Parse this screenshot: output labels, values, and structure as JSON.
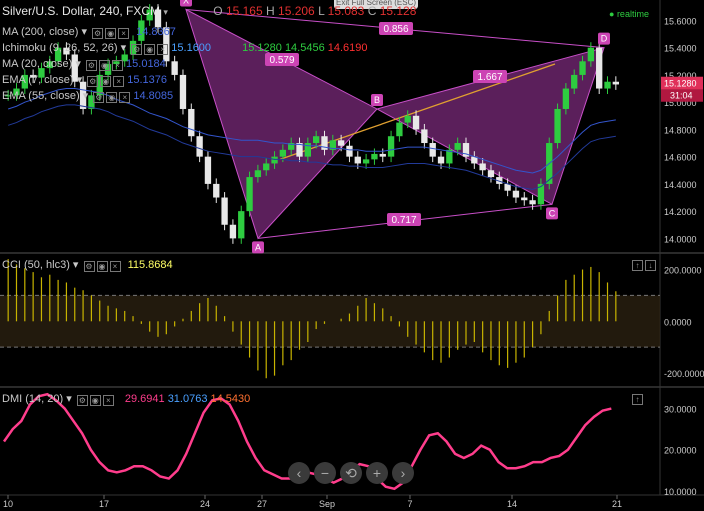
{
  "header": {
    "symbol": "Silver/U.S. Dollar, 240, FXCM",
    "ohlc": {
      "o_label": "O",
      "o": "15.165",
      "h_label": "H",
      "h": "15.206",
      "l_label": "L",
      "l": "15.083",
      "c_label": "C",
      "c": "15.128"
    },
    "realtime_label": "realtime",
    "exit_full_screen": "Exit Full Screen (ESC)"
  },
  "indicators": {
    "ma200": {
      "label": "MA (200, close)",
      "value": "14.8367"
    },
    "ichimoku": {
      "label": "Ichimoku (9, 26, 52, 26)",
      "values": [
        "15.1600",
        "15.1280",
        "14.5456",
        "14.6190"
      ]
    },
    "ma20": {
      "label": "MA (20, close)",
      "value": "15.0184"
    },
    "ema7": {
      "label": "EMA (7, close)",
      "value": "15.1376"
    },
    "ema55": {
      "label": "EMA (55, close)",
      "value": "14.8085"
    }
  },
  "cci_panel": {
    "label": "CCI (50, hlc3)",
    "value": "115.8684"
  },
  "dmi_panel": {
    "label": "DMI (14, 20)",
    "values": [
      "29.6941",
      "31.0763",
      "14.5430"
    ]
  },
  "price_tag": {
    "value": "15.1280",
    "countdown": "31:04"
  },
  "harmonic": {
    "points": [
      {
        "label": "X",
        "x": 21.0,
        "y": 15.68
      },
      {
        "label": "A",
        "x": 26.5,
        "y": 14.0
      },
      {
        "label": "B",
        "x": 3.0,
        "y": 14.95
      },
      {
        "label": "C",
        "x": 17.7,
        "y": 14.25
      },
      {
        "label": "D",
        "x": 20.0,
        "y": 15.4
      }
    ],
    "ratios": [
      {
        "label": "0.579",
        "x": 24.0,
        "y": 15.32
      },
      {
        "label": "0.856",
        "x": 9.5,
        "y": 15.55
      },
      {
        "label": "1.667",
        "x": 12.5,
        "y": 15.05
      },
      {
        "label": "0.717",
        "x": 10.5,
        "y": 14.09
      }
    ]
  },
  "colors": {
    "bg": "#000000",
    "candle_up": "#2ecc40",
    "candle_down": "#e8e8e8",
    "pattern_fill": "#7a2a7a",
    "pattern_line": "#c84fc8",
    "cci_bar": "#c8b400",
    "cci_line": "#ffff66",
    "dmi_line": "#ff3d8c",
    "ma_line": "#3355cc",
    "label_bg": "#cc44b4",
    "price_tag_bg": "#e0305a"
  },
  "toolbar": {
    "icons": [
      "scroll-left-icon",
      "zoom-out-icon",
      "reset-icon",
      "zoom-in-icon",
      "scroll-right-icon"
    ]
  },
  "chart_data": [
    {
      "type": "candlestick",
      "title": "Silver/U.S. Dollar, 240, FXCM",
      "x_ticks": [
        {
          "pos": 10,
          "label": "10"
        },
        {
          "pos": 17,
          "label": "17"
        },
        {
          "pos": 24,
          "label": "24"
        },
        {
          "pos": 27,
          "label": "27"
        },
        {
          "pos": 31,
          "label": "Sep"
        },
        {
          "pos": 7,
          "label": "7"
        },
        {
          "pos": 14,
          "label": "14"
        },
        {
          "pos": 21,
          "label": "21"
        }
      ],
      "ylim": [
        13.9,
        15.75
      ],
      "y_ticks": [
        "15.6000",
        "15.4000",
        "15.2000",
        "15.0000",
        "14.8000",
        "14.6000",
        "14.4000",
        "14.2000",
        "14.0000"
      ],
      "close_series": [
        15.05,
        15.1,
        15.2,
        15.18,
        15.25,
        15.3,
        15.4,
        15.35,
        15.15,
        14.95,
        15.05,
        15.2,
        15.28,
        15.3,
        15.35,
        15.45,
        15.6,
        15.68,
        15.55,
        15.3,
        15.2,
        14.95,
        14.75,
        14.6,
        14.4,
        14.3,
        14.1,
        14.0,
        14.2,
        14.45,
        14.5,
        14.55,
        14.6,
        14.65,
        14.7,
        14.6,
        14.7,
        14.75,
        14.65,
        14.72,
        14.68,
        14.6,
        14.55,
        14.58,
        14.62,
        14.6,
        14.75,
        14.85,
        14.9,
        14.8,
        14.7,
        14.6,
        14.55,
        14.65,
        14.7,
        14.6,
        14.55,
        14.5,
        14.45,
        14.4,
        14.35,
        14.3,
        14.28,
        14.25,
        14.4,
        14.7,
        14.95,
        15.1,
        15.2,
        15.3,
        15.4,
        15.1,
        15.15,
        15.13
      ],
      "ma_series": [
        14.95,
        14.97,
        15.0,
        15.02,
        15.05,
        15.07,
        15.09,
        15.1,
        15.1,
        15.09,
        15.08,
        15.07,
        15.05,
        15.02,
        15.0,
        14.98,
        14.95,
        14.92,
        14.9,
        14.88,
        14.85,
        14.82,
        14.8,
        14.78,
        14.76,
        14.75,
        14.74,
        14.73,
        14.72,
        14.72,
        14.72,
        14.71,
        14.7,
        14.7,
        14.69,
        14.69,
        14.68,
        14.68,
        14.67,
        14.66,
        14.66,
        14.65,
        14.65,
        14.64,
        14.64,
        14.64,
        14.65,
        14.66,
        14.67,
        14.67,
        14.67,
        14.66,
        14.65,
        14.64,
        14.63,
        14.62,
        14.6,
        14.58,
        14.56,
        14.54,
        14.52,
        14.5,
        14.49,
        14.48,
        14.5,
        14.55,
        14.6,
        14.66,
        14.72,
        14.78,
        14.83,
        14.85,
        14.86,
        14.87
      ]
    },
    {
      "type": "bar",
      "title": "CCI (50, hlc3)",
      "ylim": [
        -250,
        260
      ],
      "y_ticks": [
        "200.0000",
        "0.0000",
        "-200.0000"
      ],
      "levels": [
        100,
        -100
      ],
      "values": [
        240,
        220,
        205,
        190,
        170,
        180,
        160,
        150,
        130,
        120,
        100,
        80,
        60,
        50,
        40,
        20,
        -10,
        -40,
        -60,
        -50,
        -20,
        10,
        40,
        70,
        90,
        60,
        20,
        -40,
        -90,
        -140,
        -190,
        -220,
        -210,
        -170,
        -150,
        -110,
        -80,
        -30,
        -10,
        0,
        10,
        30,
        60,
        90,
        70,
        50,
        20,
        -20,
        -60,
        -90,
        -120,
        -150,
        -160,
        -140,
        -110,
        -90,
        -80,
        -120,
        -150,
        -170,
        -180,
        -160,
        -140,
        -100,
        -50,
        40,
        100,
        160,
        180,
        200,
        210,
        190,
        150,
        116
      ],
      "series_name": "CCI"
    },
    {
      "type": "line",
      "title": "DMI (14, 20)",
      "ylim": [
        9,
        35
      ],
      "y_ticks": [
        "30.0000",
        "20.0000",
        "10.0000"
      ],
      "values": [
        22,
        25,
        27,
        31,
        33,
        33.5,
        32,
        30,
        27,
        24,
        20,
        17,
        15,
        14.5,
        15,
        16,
        16,
        15,
        13.5,
        13,
        15,
        19,
        24,
        29,
        32,
        32.5,
        31,
        27,
        22,
        18,
        15,
        14,
        13,
        13,
        14,
        14.5,
        14,
        13,
        12,
        13,
        15,
        16.5,
        16,
        13,
        11,
        10.5,
        12,
        16,
        20,
        23.5,
        24,
        22,
        19,
        18,
        19,
        21,
        20,
        17,
        15.5,
        15.5,
        16,
        17,
        17,
        18,
        18.5,
        20,
        23,
        26,
        28,
        29.5,
        30
      ],
      "series_name": "DMI"
    }
  ]
}
